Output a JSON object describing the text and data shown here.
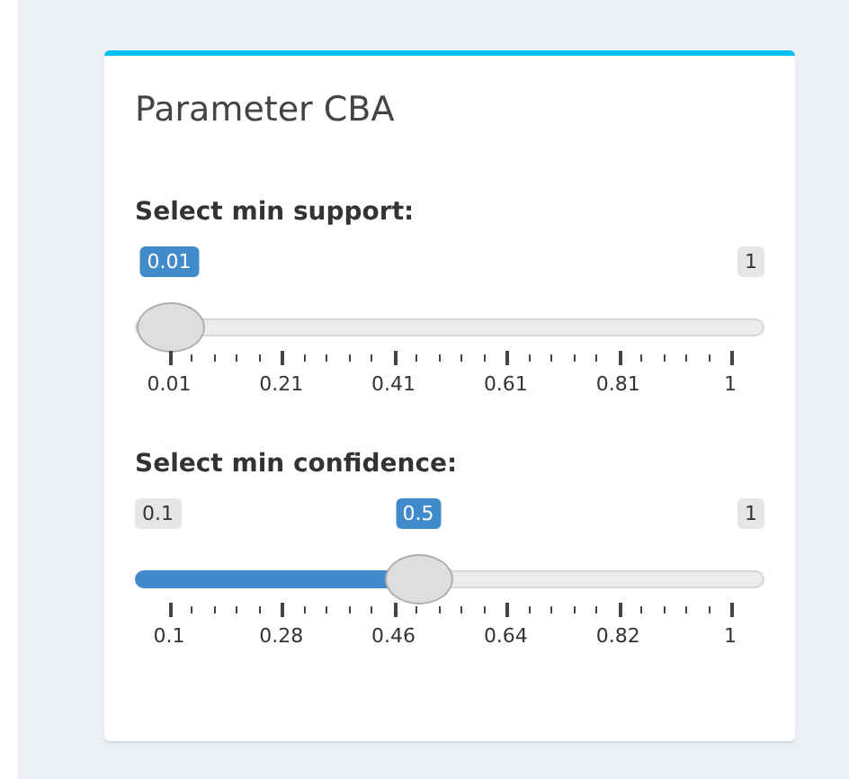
{
  "box": {
    "title": "Parameter CBA"
  },
  "sliders": [
    {
      "label": "Select min support:",
      "value_label": "0.01",
      "max_label": "1",
      "level": 0,
      "ticks": [
        "0.01",
        "0.21",
        "0.41",
        "0.61",
        "0.81",
        "1"
      ]
    },
    {
      "label": "Select min confidence:",
      "min_label": "0.1",
      "value_label": "0.5",
      "max_label": "1",
      "level": 0.444,
      "ticks": [
        "0.1",
        "0.28",
        "0.46",
        "0.64",
        "0.82",
        "1"
      ]
    }
  ]
}
